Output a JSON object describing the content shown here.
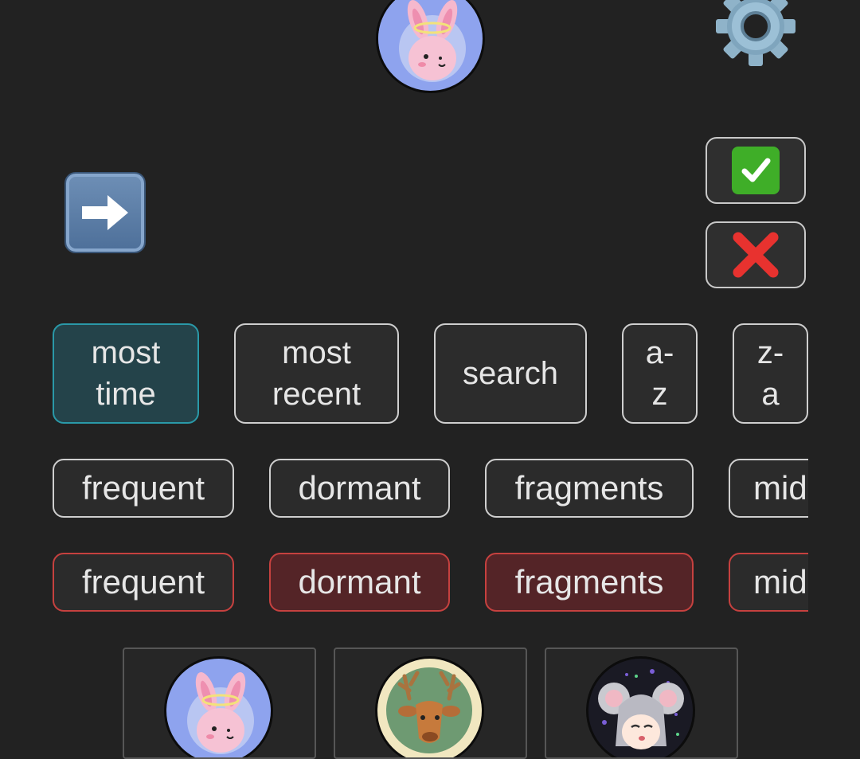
{
  "header": {
    "avatar_icon": "angel-bunny-avatar",
    "settings_icon": "gear-icon"
  },
  "action_buttons": {
    "go_icon": "right-arrow-icon",
    "confirm_icon": "check-mark-icon",
    "cancel_icon": "cross-mark-icon"
  },
  "sort_options": [
    {
      "line1": "most",
      "line2": "time",
      "active": true
    },
    {
      "line1": "most",
      "line2": "recent",
      "active": false
    },
    {
      "line1": "search",
      "line2": "",
      "active": false
    },
    {
      "line1": "a-",
      "line2": "z",
      "active": false
    },
    {
      "line1": "z-",
      "line2": "a",
      "active": false
    }
  ],
  "include_filters": [
    "frequent",
    "dormant",
    "fragments",
    "mid"
  ],
  "exclude_filters": [
    {
      "label": "frequent",
      "on": false
    },
    {
      "label": "dormant",
      "on": true
    },
    {
      "label": "fragments",
      "on": true
    },
    {
      "label": "mid",
      "on": false
    }
  ],
  "cards": [
    {
      "avatar": "angel-bunny-avatar"
    },
    {
      "avatar": "deer-avatar"
    },
    {
      "avatar": "mouse-girl-avatar"
    }
  ],
  "colors": {
    "background": "#222222",
    "active_sort_border": "#2a99a8",
    "active_sort_fill": "#24434a",
    "exclude_border": "#c6413f",
    "exclude_fill": "#542427"
  }
}
